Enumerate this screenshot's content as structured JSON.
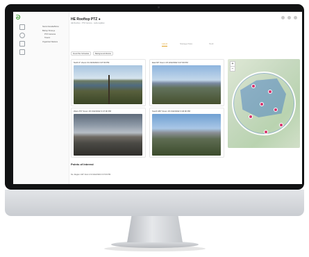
{
  "app": {
    "logo": "ᘐ",
    "project_title": "HE Rooftop PTZ ●",
    "breadcrumb": "HE Rooftop  ·  PTZ Camera  ·  Lat/Long/Elev"
  },
  "nav_panel": {
    "items": [
      {
        "label": "Sierra Nevada/Mono"
      },
      {
        "label": "Bishop Shoreys"
      },
      {
        "label": "PTZ Cameras"
      },
      {
        "label": "Towers"
      },
      {
        "label": "Organized Stations"
      }
    ]
  },
  "tabs": [
    {
      "label": "Latest"
    },
    {
      "label": "Storage Pass"
    },
    {
      "label": "Toolt"
    }
  ],
  "toolbar": {
    "filter_chip": "Fixed Pan Schedule",
    "select_chip": "Background Monitor"
  },
  "cameras": [
    {
      "label": "North  0°  Zoom 1%   9/22/2022 3:47:00 PM"
    },
    {
      "label": "East  90°  Zoom 1%   9/22/2022 3:47:00 PM"
    },
    {
      "label": "West  270°  Zoom 1%   9/22/2022 3:47:00 PM"
    },
    {
      "label": "South  180°  Zoom 1%   9/22/2022 3:46:00 PM"
    }
  ],
  "map": {
    "zoom_in": "+",
    "zoom_out": "−"
  },
  "poi": {
    "heading": "Points of Interest",
    "first_item": "No. Region  140°  Zoom 1%   9/22/2022 3:47:00 PM"
  },
  "colors": {
    "accent": "#e0a020",
    "brand": "#3a9b2c",
    "map_overlay": "#3a76c4",
    "pin": "#d6336c"
  }
}
